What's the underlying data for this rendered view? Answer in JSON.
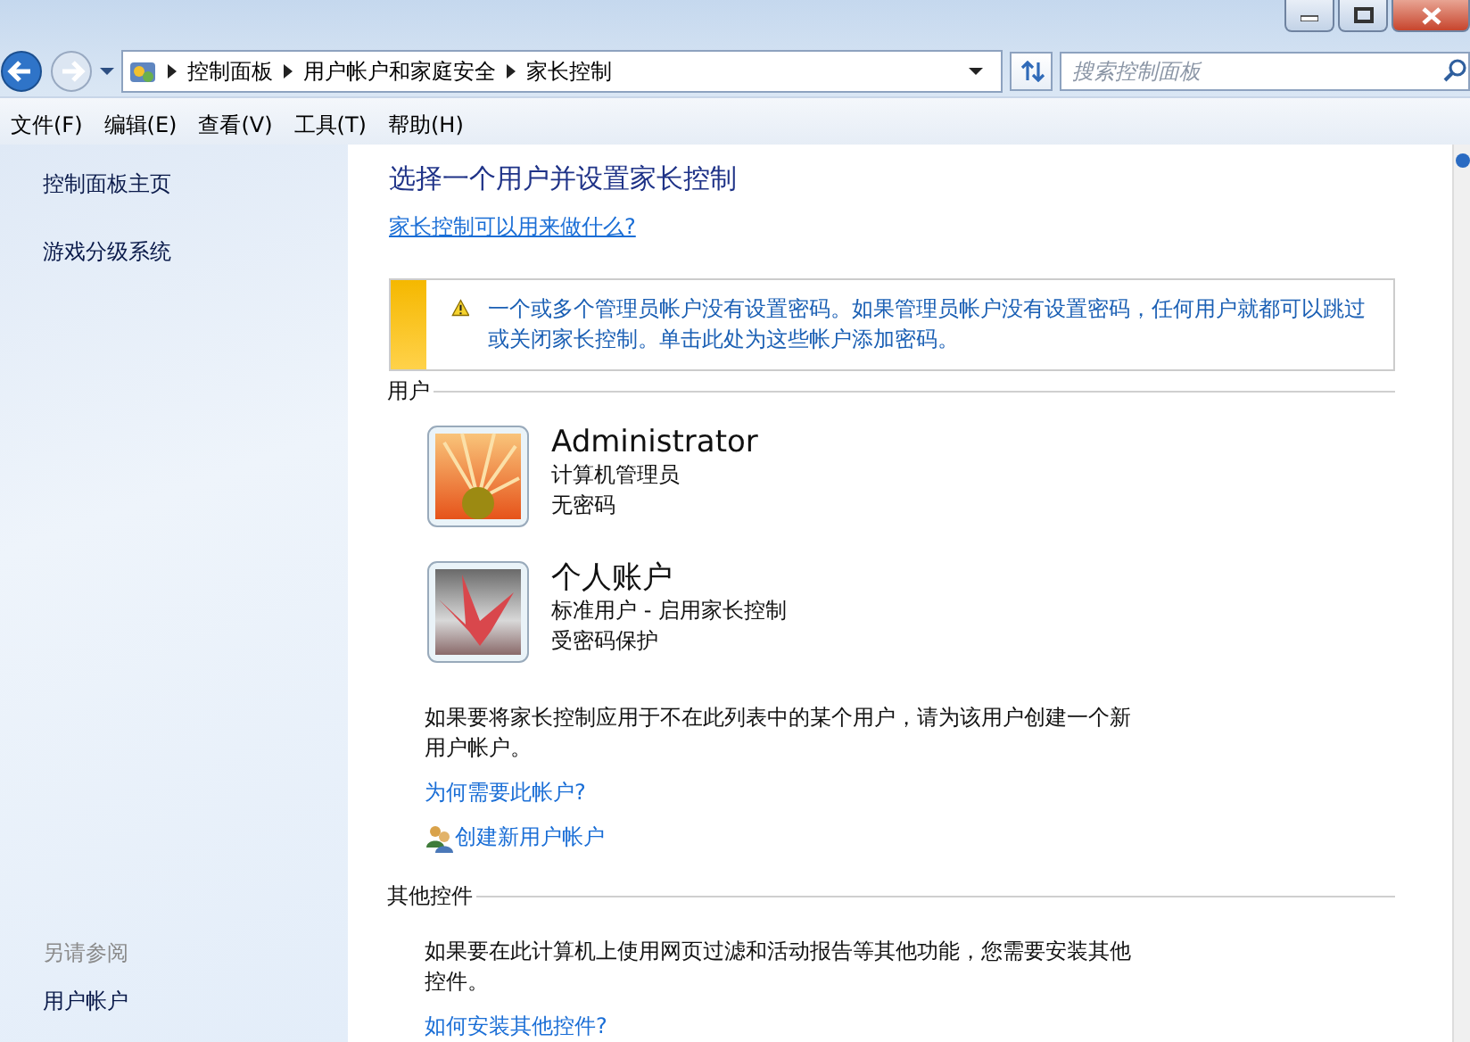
{
  "breadcrumb": [
    "控制面板",
    "用户帐户和家庭安全",
    "家长控制"
  ],
  "search": {
    "placeholder": "搜索控制面板"
  },
  "menu": [
    "文件(F)",
    "编辑(E)",
    "查看(V)",
    "工具(T)",
    "帮助(H)"
  ],
  "sidebar": {
    "links": [
      "控制面板主页",
      "游戏分级系统"
    ],
    "see_also_title": "另请参阅",
    "see_also": [
      "用户帐户"
    ]
  },
  "content": {
    "title": "选择一个用户并设置家长控制",
    "help_link": "家长控制可以用来做什么?",
    "warning": "一个或多个管理员帐户没有设置密码。如果管理员帐户没有设置密码，任何用户就都可以跳过或关闭家长控制。单击此处为这些帐户添加密码。",
    "users_heading": "用户",
    "users": [
      {
        "name": "Administrator",
        "lines": [
          "计算机管理员",
          "无密码"
        ],
        "kind": "flower"
      },
      {
        "name": "个人账户",
        "lines": [
          "标准用户 - 启用家长控制",
          "受密码保护"
        ],
        "kind": "crane"
      }
    ],
    "note": "如果要将家长控制应用于不在此列表中的某个用户，请为该用户创建一个新用户帐户。",
    "why_link": "为何需要此帐户?",
    "create_link": "创建新用户帐户",
    "other_heading": "其他控件",
    "other_note": "如果要在此计算机上使用网页过滤和活动报告等其他功能，您需要安装其他控件。",
    "other_link": "如何安装其他控件?"
  }
}
